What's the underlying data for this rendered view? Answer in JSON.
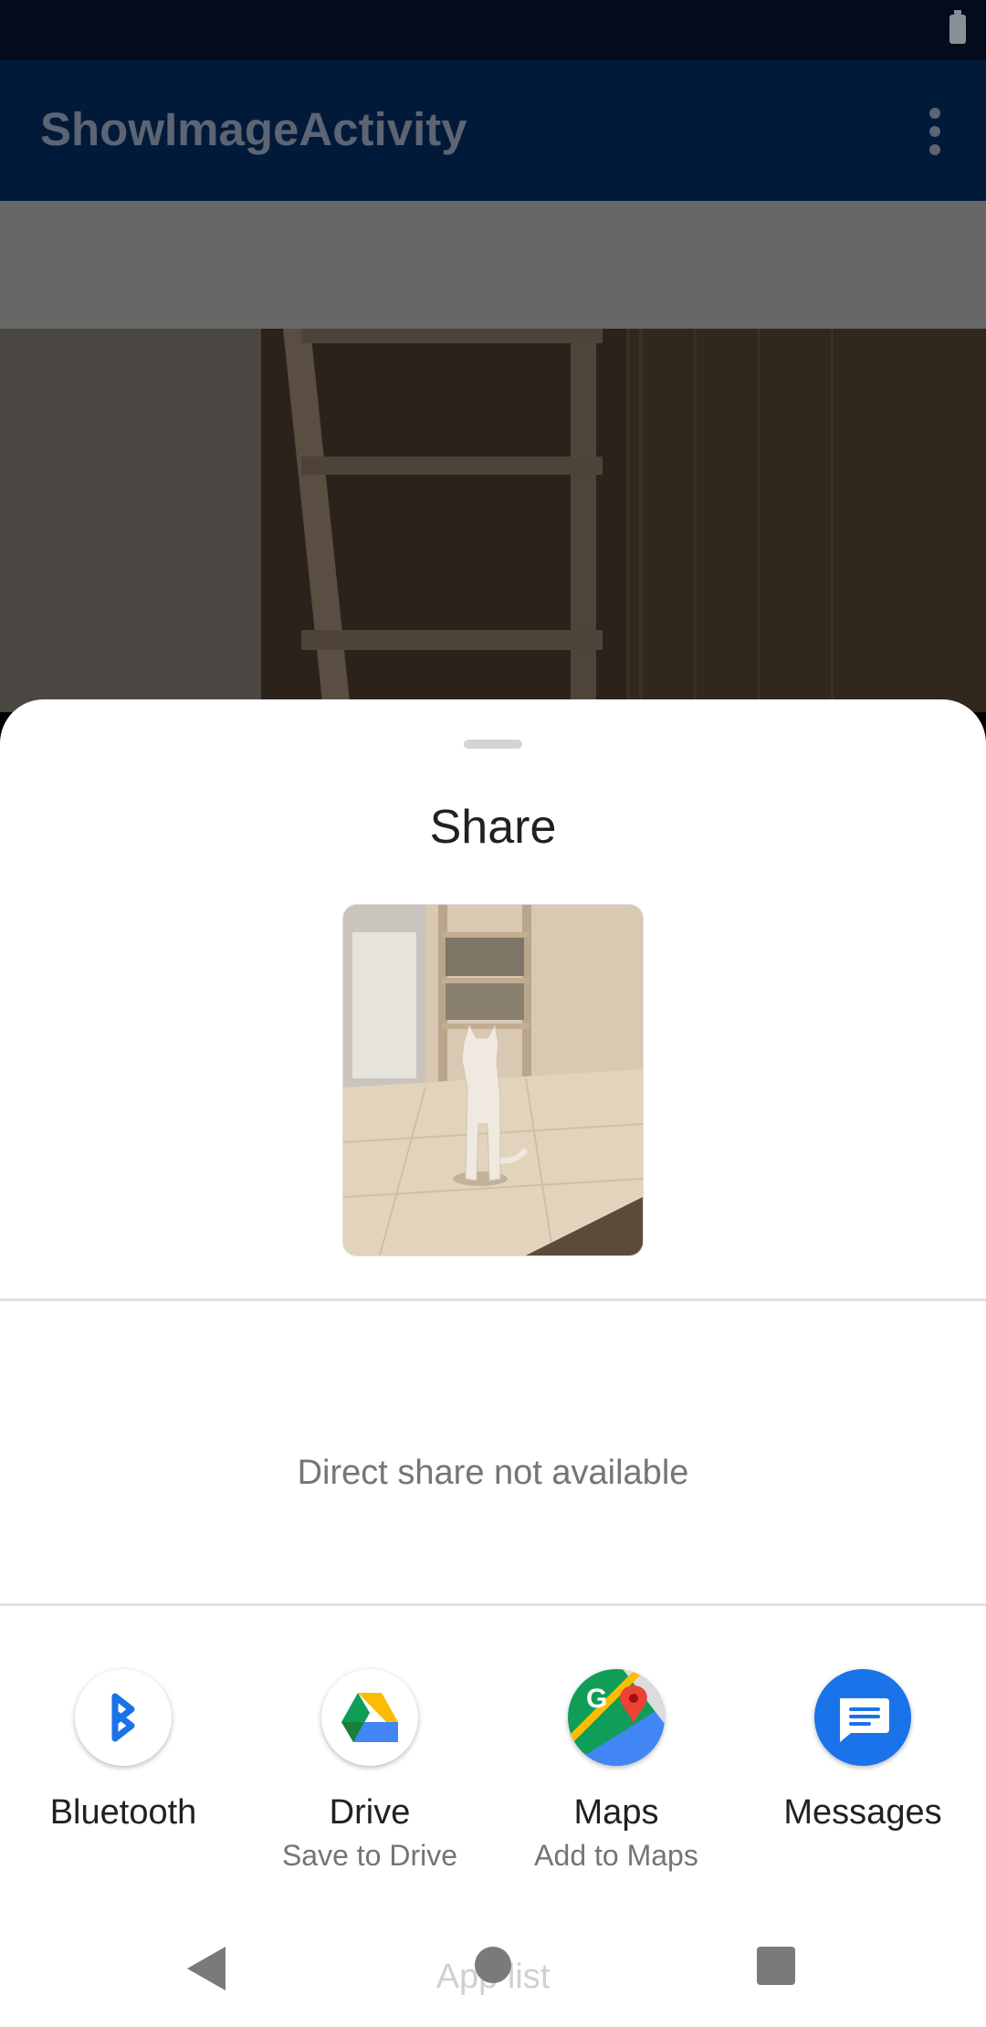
{
  "app_bar": {
    "title": "ShowImageActivity"
  },
  "share_sheet": {
    "title": "Share",
    "direct_share_message": "Direct share not available",
    "apps": [
      {
        "label": "Bluetooth",
        "sub": "",
        "icon": "bluetooth-icon"
      },
      {
        "label": "Drive",
        "sub": "Save to Drive",
        "icon": "google-drive-icon"
      },
      {
        "label": "Maps",
        "sub": "Add to Maps",
        "icon": "google-maps-icon"
      },
      {
        "label": "Messages",
        "sub": "",
        "icon": "messages-icon"
      }
    ],
    "app_list_label": "App list"
  },
  "colors": {
    "status_bar": "#020c1d",
    "app_bar": "#021a3a",
    "sheet": "#ffffff",
    "bluetooth": "#1a73e8",
    "messages": "#1a73e8"
  }
}
